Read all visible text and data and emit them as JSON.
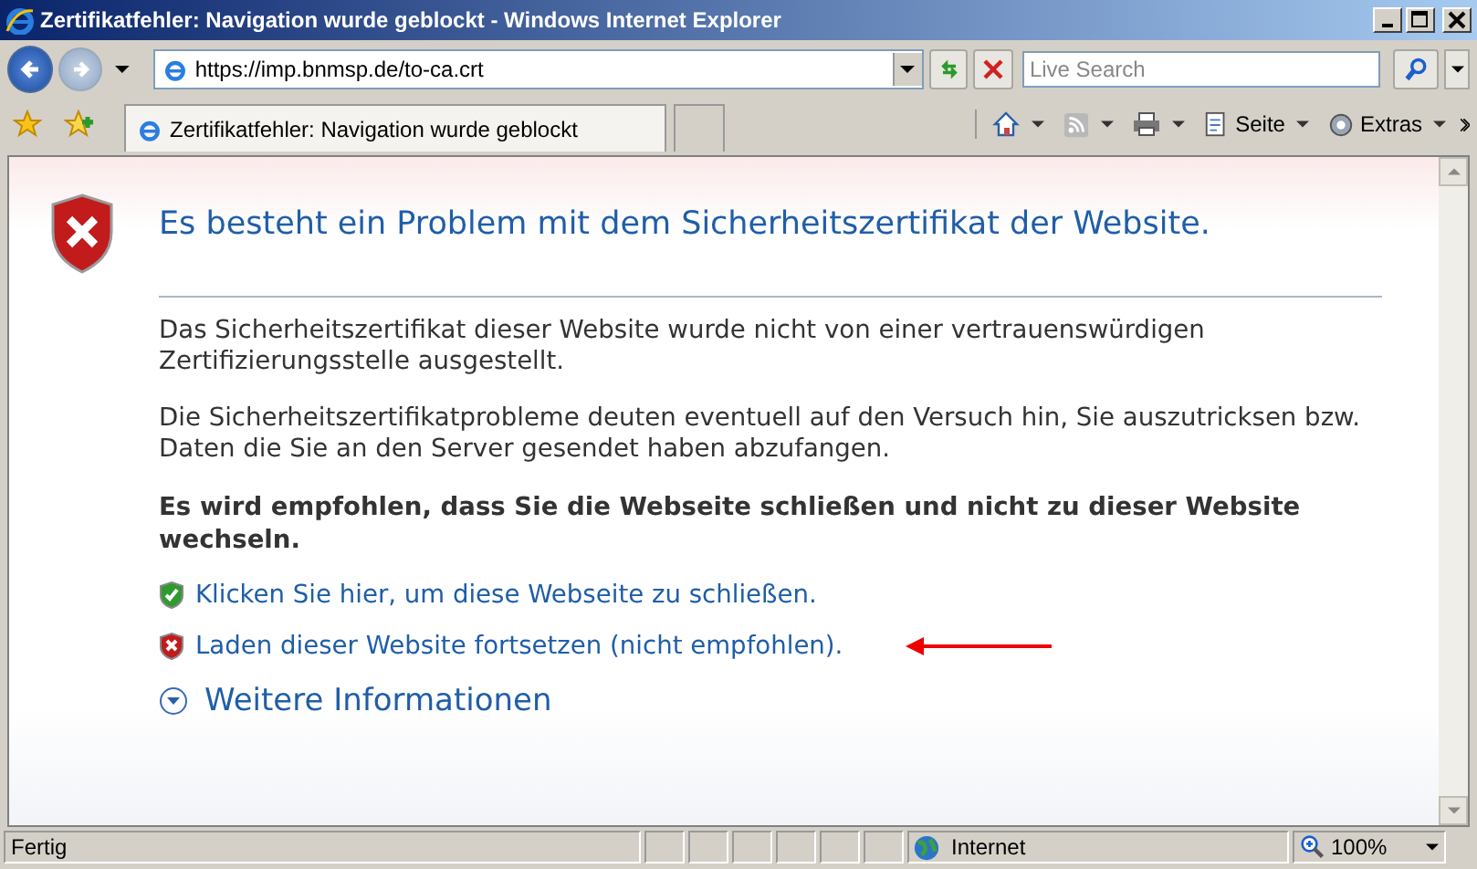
{
  "window": {
    "title": "Zertifikatfehler: Navigation wurde geblockt - Windows Internet Explorer"
  },
  "address_bar": {
    "value": "https://imp.bnmsp.de/to-ca.crt"
  },
  "search": {
    "placeholder": "Live Search"
  },
  "tabs": [
    {
      "label": "Zertifikatfehler: Navigation wurde geblockt",
      "selected": true
    }
  ],
  "command_bar": [
    {
      "kind": "home"
    },
    {
      "kind": "feeds"
    },
    {
      "kind": "print"
    },
    {
      "label": "Seite",
      "kind": "page"
    },
    {
      "label": "Extras",
      "kind": "tools"
    }
  ],
  "page": {
    "heading": "Es besteht ein Problem mit dem Sicherheitszertifikat der Website.",
    "paragraphs": [
      "Das Sicherheitszertifikat dieser Website wurde nicht von einer vertrauenswürdigen Zertifizierungsstelle ausgestellt.",
      "Die Sicherheitszertifikatprobleme deuten eventuell auf den Versuch hin, Sie auszutricksen bzw. Daten die Sie an den Server gesendet haben abzufangen."
    ],
    "recommendation": "Es wird empfohlen, dass Sie die Webseite schließen und nicht zu dieser Website wechseln.",
    "links": [
      {
        "label": "Klicken Sie hier, um diese Webseite zu schließen.",
        "kind": "safe"
      },
      {
        "label": "Laden dieser Website fortsetzen (nicht empfohlen).",
        "kind": "unsafe"
      }
    ],
    "more_info": "Weitere Informationen"
  },
  "status_bar": {
    "status": "Fertig",
    "zone": "Internet",
    "zoom": "100%"
  }
}
